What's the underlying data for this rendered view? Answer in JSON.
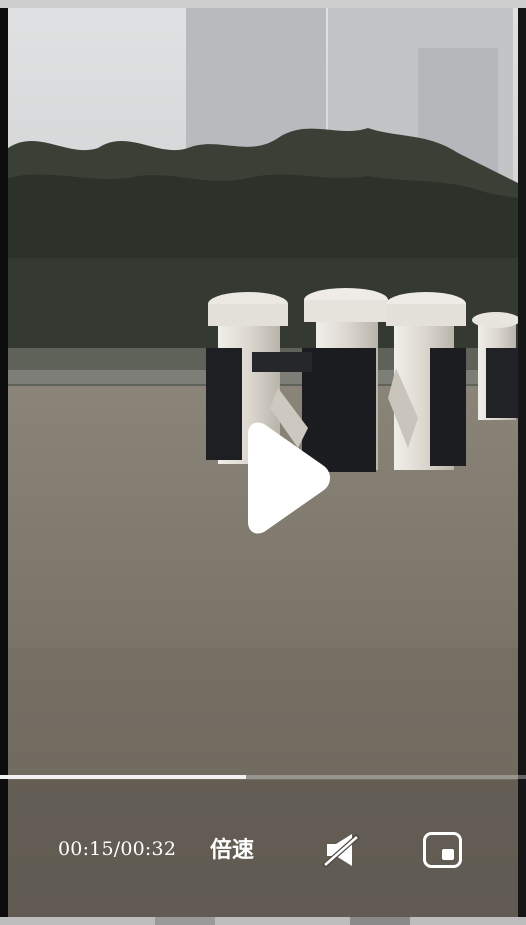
{
  "player": {
    "time_display": "00:15/00:32",
    "speed_label": "倍速",
    "progress": 0.468,
    "icons": {
      "play": "play-icon",
      "mute": "muted-speaker-icon",
      "pip": "picture-in-picture-icon"
    },
    "colors": {
      "water": "#7d7669",
      "sky": "#d8dadb",
      "trees": "#2b3128",
      "pillar": "#d9d6cf"
    }
  }
}
